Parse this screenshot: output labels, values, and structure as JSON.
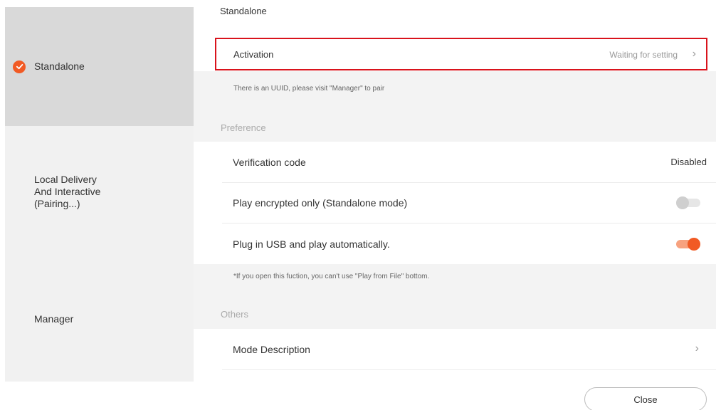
{
  "sidebar": {
    "items": [
      {
        "label": "Standalone",
        "active": true
      },
      {
        "label": "Local Delivery\nAnd Interactive\n(Pairing...)"
      },
      {
        "label": "Manager"
      }
    ],
    "check_icon": "check-circle-icon",
    "accent": "#f15a24"
  },
  "main": {
    "title": "Standalone",
    "activation": {
      "label": "Activation",
      "value": "Waiting for setting",
      "icon": "chevron-right-icon"
    },
    "uuid_hint": "There is an UUID, please visit \"Manager\" to pair",
    "preference_header": "Preference",
    "verification": {
      "label": "Verification code",
      "value": "Disabled"
    },
    "play_encrypted": {
      "label": "Play encrypted only (Standalone mode)",
      "enabled": false
    },
    "plug_usb": {
      "label": "Plug in USB and play automatically.",
      "enabled": true
    },
    "usb_hint": "*If you open this fuction, you can't use \"Play from File\" bottom.",
    "others_header": "Others",
    "mode_description": {
      "label": "Mode Description",
      "icon": "chevron-right-icon"
    }
  },
  "footer": {
    "close_label": "Close"
  },
  "colors": {
    "highlight_border": "#d9131c",
    "toggle_on": "#f15a24"
  }
}
